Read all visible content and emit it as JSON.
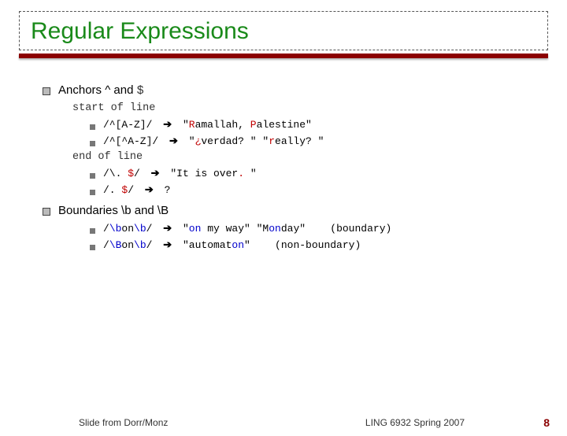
{
  "title": "Regular Expressions",
  "section1": {
    "heading_prefix": "Anchors ^ and ",
    "heading_mono": "$",
    "sub1": "start of line",
    "item1": {
      "regex": "/^[A-Z]/",
      "result_q1": "\"",
      "result_hl1": "R",
      "result_mid": "amallah, ",
      "result_hl2": "P",
      "result_end": "alestine\""
    },
    "item2": {
      "regex": "/^[^A-Z]/",
      "result_q1": "\"",
      "result_hl1": "¿",
      "result_mid": "verdad? \" \"",
      "result_hl2": "r",
      "result_end": "eally? \""
    },
    "sub2": "end of line",
    "item3": {
      "regex_a": "/\\. ",
      "regex_b": "$",
      "regex_c": "/",
      "result_q1": "\"It is over",
      "result_hl1": ".",
      "result_end": " \""
    },
    "item4": {
      "regex_a": "/. ",
      "regex_b": "$",
      "regex_c": "/",
      "result": "?"
    }
  },
  "section2": {
    "heading": "Boundaries \\b and \\B",
    "item1": {
      "r1": "/",
      "r2": "\\b",
      "r3": "on",
      "r4": "\\b",
      "r5": "/",
      "res_a": "\"",
      "res_b": "on",
      "res_c": " my way\" \"M",
      "res_d": "on",
      "res_e": "day\"",
      "note": "(boundary)"
    },
    "item2": {
      "r1": "/",
      "r2": "\\B",
      "r3": "on",
      "r4": "\\b",
      "r5": "/",
      "res_a": "\"automat",
      "res_b": "on",
      "res_c": "\"",
      "note": "(non-boundary)"
    }
  },
  "footer": {
    "credit": "Slide from Dorr/Monz",
    "course": "LING 6932 Spring 2007",
    "page": "8"
  },
  "arrow": "➔"
}
